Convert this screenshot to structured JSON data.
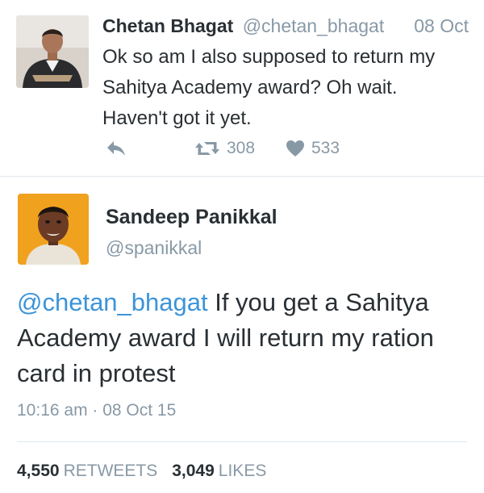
{
  "tweet1": {
    "name": "Chetan Bhagat",
    "handle": "@chetan_bhagat",
    "date": "08 Oct",
    "text_lines": [
      "Ok so am I also supposed to return my",
      "Sahitya Academy award? Oh wait.",
      "Haven't got it yet."
    ],
    "actions": {
      "reply_icon": "reply-icon",
      "retweet_icon": "retweet-icon",
      "retweet_count": "308",
      "like_icon": "heart-icon",
      "like_count": "533"
    }
  },
  "tweet2": {
    "name": "Sandeep Panikkal",
    "handle": "@spanikkal",
    "mention": "@chetan_bhagat",
    "text_after_mention": " If you get a Sahitya Academy award I will return my ration card in protest",
    "timestamp": "10:16 am · 08 Oct 15",
    "retweets_count": "4,550",
    "retweets_label": "RETWEETS",
    "likes_count": "3,049",
    "likes_label": "LIKES"
  },
  "colors": {
    "text": "#292f33",
    "muted": "#8899a6",
    "link": "#3b94d9",
    "divider": "#e1e8ed",
    "avatar2_bg": "#f0a21e"
  }
}
